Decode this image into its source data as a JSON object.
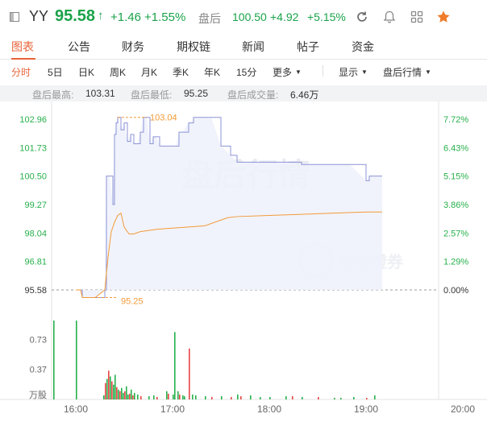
{
  "header": {
    "ticker": "YY",
    "price": "95.58",
    "price_arrow": "↑",
    "change": "+1.46",
    "change_pct": "+1.55%",
    "after_hours_label": "盘后",
    "after_hours_price": "100.50",
    "after_hours_change": "+4.92",
    "after_hours_pct": "+5.15%",
    "icons": [
      "refresh-icon",
      "bell-icon",
      "grid-icon",
      "star-icon"
    ]
  },
  "tabs": [
    {
      "label": "图表",
      "active": true
    },
    {
      "label": "公告",
      "active": false
    },
    {
      "label": "财务",
      "active": false
    },
    {
      "label": "期权链",
      "active": false
    },
    {
      "label": "新闻",
      "active": false
    },
    {
      "label": "帖子",
      "active": false
    },
    {
      "label": "资金",
      "active": false
    }
  ],
  "periods": [
    {
      "label": "分时",
      "active": true
    },
    {
      "label": "5日"
    },
    {
      "label": "日K"
    },
    {
      "label": "周K"
    },
    {
      "label": "月K"
    },
    {
      "label": "季K"
    },
    {
      "label": "年K"
    },
    {
      "label": "15分"
    },
    {
      "label": "更多"
    }
  ],
  "period_dropdowns": {
    "display": "显示",
    "after_hours": "盘后行情"
  },
  "stats": {
    "high_label": "盘后最高:",
    "high_value": "103.31",
    "low_label": "盘后最低:",
    "low_value": "95.25",
    "volume_label": "盘后成交量:",
    "volume_value": "6.46万"
  },
  "chart_data": {
    "type": "line",
    "watermark_text": "盘后行情",
    "brand_watermark": "老虎證券",
    "prev_close": 95.58,
    "y_ticks": [
      "102.96",
      "101.73",
      "100.50",
      "99.27",
      "98.04",
      "96.81",
      "95.58"
    ],
    "y_ticks_right": [
      "7.72%",
      "6.43%",
      "5.15%",
      "3.86%",
      "2.57%",
      "1.29%",
      "0.00%"
    ],
    "ylim": [
      95.58,
      102.96
    ],
    "x_ticks": [
      "16:00",
      "17:00",
      "18:00",
      "19:00",
      "20:00"
    ],
    "annotations": {
      "high": "103.04",
      "low": "95.25"
    },
    "colors": {
      "price_line": "#8c93d6",
      "avg_line": "#f29a38",
      "up": "#e64545",
      "down": "#27b04b",
      "tick_green": "#27b04b"
    },
    "series": [
      {
        "name": "price",
        "minutes": [
          0,
          3,
          4,
          12,
          18,
          19,
          21,
          23,
          24,
          25,
          26,
          28,
          30,
          32,
          34,
          36,
          38,
          40,
          42,
          44,
          46,
          48,
          50,
          52,
          56,
          60,
          62,
          64,
          66,
          70,
          72,
          73,
          74,
          76,
          80,
          84,
          90,
          96,
          100,
          110,
          120,
          130,
          140,
          150,
          160,
          170,
          180,
          181,
          182,
          186,
          190
        ],
        "values": [
          95.58,
          95.58,
          95.25,
          95.25,
          95.58,
          100.5,
          100.5,
          99.27,
          102.3,
          102.8,
          103.04,
          102.5,
          102.8,
          102.0,
          102.3,
          101.9,
          101.9,
          102.4,
          103.04,
          103.04,
          101.9,
          102.2,
          102.2,
          101.8,
          101.8,
          101.8,
          101.8,
          102.4,
          102.4,
          102.8,
          102.8,
          103.04,
          103.04,
          103.04,
          103.04,
          103.04,
          101.8,
          101.4,
          101.1,
          101.1,
          101.1,
          101.1,
          101.0,
          101.0,
          101.0,
          101.0,
          100.3,
          100.3,
          100.5,
          100.5,
          100.5
        ]
      },
      {
        "name": "average",
        "minutes": [
          0,
          3,
          4,
          12,
          18,
          20,
          22,
          24,
          26,
          28,
          30,
          33,
          36,
          40,
          50,
          60,
          70,
          80,
          94,
          100,
          120,
          140,
          160,
          180,
          190
        ],
        "values": [
          95.58,
          95.58,
          95.25,
          95.25,
          95.58,
          97.0,
          98.1,
          98.5,
          98.8,
          98.9,
          98.3,
          98.0,
          98.0,
          98.1,
          98.2,
          98.25,
          98.3,
          98.35,
          98.7,
          98.75,
          98.8,
          98.85,
          98.9,
          98.95,
          98.95
        ]
      }
    ],
    "volume": {
      "y_ticks": [
        "0.73",
        "0.37"
      ],
      "unit": "万股",
      "bars": [
        {
          "m": 0,
          "v": 0.96,
          "c": "down"
        },
        {
          "m": 17,
          "v": 0.05,
          "c": "down"
        },
        {
          "m": 18,
          "v": 0.2,
          "c": "up"
        },
        {
          "m": 19,
          "v": 0.25,
          "c": "down"
        },
        {
          "m": 20,
          "v": 0.35,
          "c": "up"
        },
        {
          "m": 21,
          "v": 0.28,
          "c": "down"
        },
        {
          "m": 22,
          "v": 0.22,
          "c": "up"
        },
        {
          "m": 23,
          "v": 0.18,
          "c": "down"
        },
        {
          "m": 24,
          "v": 0.3,
          "c": "down"
        },
        {
          "m": 25,
          "v": 0.15,
          "c": "up"
        },
        {
          "m": 26,
          "v": 0.12,
          "c": "down"
        },
        {
          "m": 27,
          "v": 0.1,
          "c": "up"
        },
        {
          "m": 28,
          "v": 0.14,
          "c": "down"
        },
        {
          "m": 29,
          "v": 0.08,
          "c": "down"
        },
        {
          "m": 30,
          "v": 0.1,
          "c": "up"
        },
        {
          "m": 31,
          "v": 0.16,
          "c": "down"
        },
        {
          "m": 32,
          "v": 0.06,
          "c": "down"
        },
        {
          "m": 33,
          "v": 0.07,
          "c": "up"
        },
        {
          "m": 34,
          "v": 0.12,
          "c": "down"
        },
        {
          "m": 35,
          "v": 0.05,
          "c": "up"
        },
        {
          "m": 36,
          "v": 0.08,
          "c": "down"
        },
        {
          "m": 38,
          "v": 0.06,
          "c": "down"
        },
        {
          "m": 40,
          "v": 0.04,
          "c": "up"
        },
        {
          "m": 45,
          "v": 0.04,
          "c": "down"
        },
        {
          "m": 48,
          "v": 0.05,
          "c": "down"
        },
        {
          "m": 50,
          "v": 0.03,
          "c": "up"
        },
        {
          "m": 56,
          "v": 0.1,
          "c": "down"
        },
        {
          "m": 57,
          "v": 0.07,
          "c": "up"
        },
        {
          "m": 60,
          "v": 0.06,
          "c": "down"
        },
        {
          "m": 61,
          "v": 0.82,
          "c": "down"
        },
        {
          "m": 63,
          "v": 0.1,
          "c": "down"
        },
        {
          "m": 64,
          "v": 0.06,
          "c": "up"
        },
        {
          "m": 66,
          "v": 0.05,
          "c": "down"
        },
        {
          "m": 67,
          "v": 0.04,
          "c": "down"
        },
        {
          "m": 70,
          "v": 0.62,
          "c": "up"
        },
        {
          "m": 72,
          "v": 0.06,
          "c": "down"
        },
        {
          "m": 74,
          "v": 0.05,
          "c": "down"
        },
        {
          "m": 80,
          "v": 0.04,
          "c": "down"
        },
        {
          "m": 84,
          "v": 0.03,
          "c": "up"
        },
        {
          "m": 90,
          "v": 0.04,
          "c": "down"
        },
        {
          "m": 96,
          "v": 0.03,
          "c": "up"
        },
        {
          "m": 100,
          "v": 0.06,
          "c": "down"
        },
        {
          "m": 102,
          "v": 0.04,
          "c": "up"
        },
        {
          "m": 108,
          "v": 0.05,
          "c": "down"
        },
        {
          "m": 114,
          "v": 0.03,
          "c": "down"
        },
        {
          "m": 120,
          "v": 0.03,
          "c": "down"
        },
        {
          "m": 130,
          "v": 0.04,
          "c": "down"
        },
        {
          "m": 134,
          "v": 0.04,
          "c": "up"
        },
        {
          "m": 140,
          "v": 0.03,
          "c": "down"
        },
        {
          "m": 150,
          "v": 0.03,
          "c": "up"
        },
        {
          "m": 160,
          "v": 0.02,
          "c": "down"
        },
        {
          "m": 164,
          "v": 0.02,
          "c": "down"
        },
        {
          "m": 172,
          "v": 0.03,
          "c": "down"
        },
        {
          "m": 180,
          "v": 0.02,
          "c": "up"
        },
        {
          "m": 185,
          "v": 0.05,
          "c": "down"
        }
      ]
    }
  }
}
